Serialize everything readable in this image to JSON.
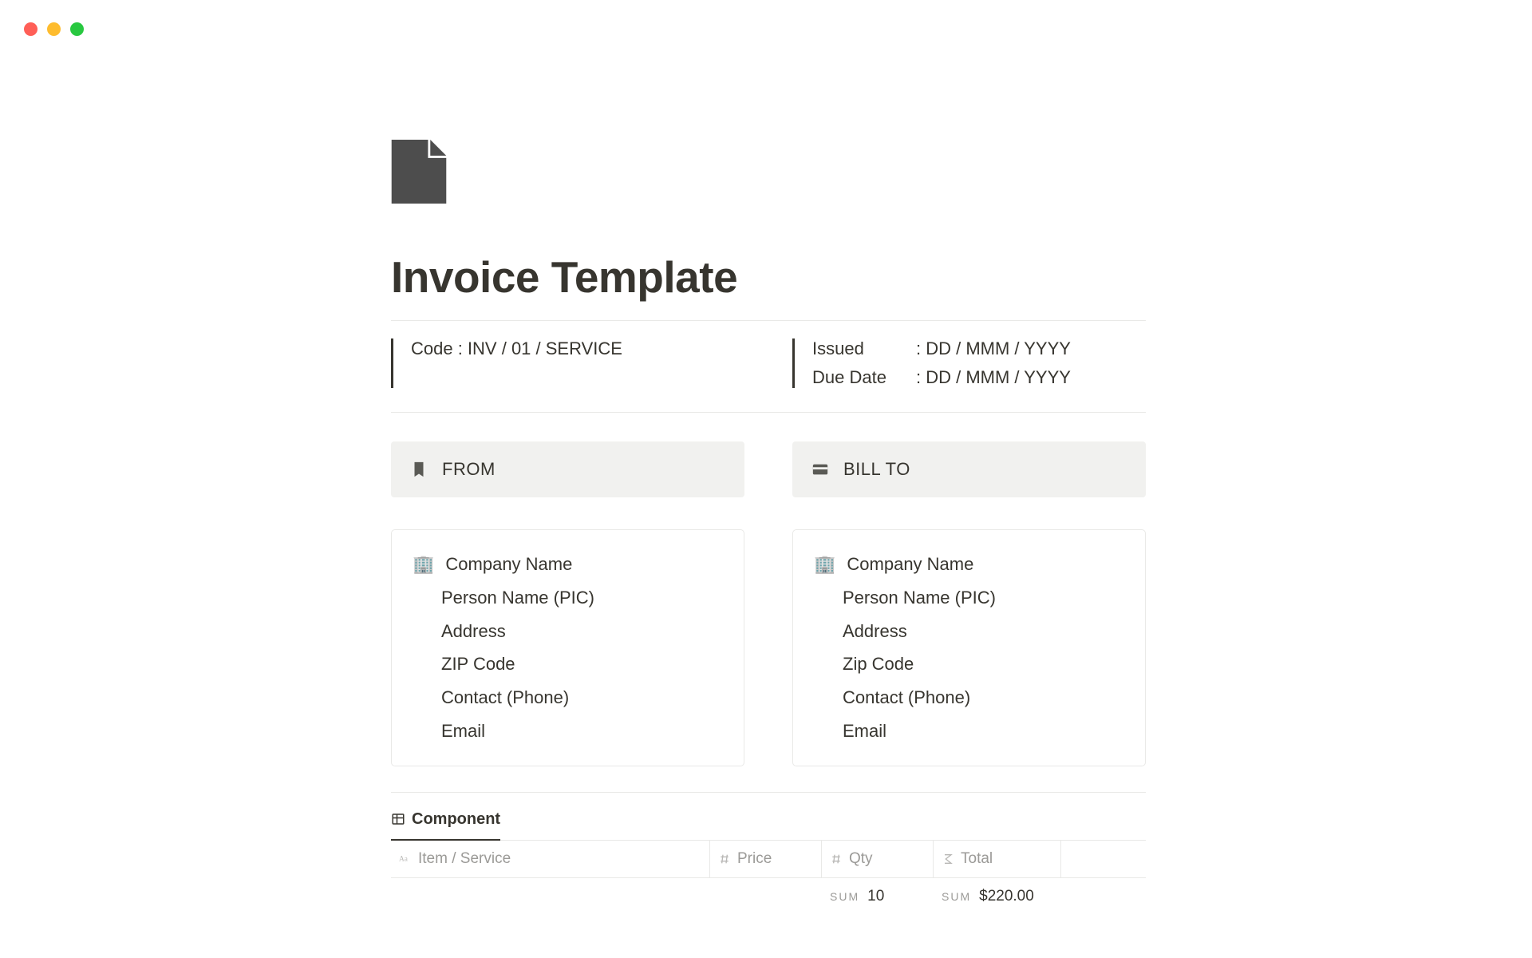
{
  "title": "Invoice Template",
  "meta": {
    "code_line": "Code : INV / 01 / SERVICE",
    "issued_label": "Issued",
    "issued_value": ": DD / MMM / YYYY",
    "due_label": "Due Date",
    "due_value": ": DD / MMM / YYYY"
  },
  "from": {
    "heading": "FROM",
    "company": "Company Name",
    "person": "Person Name (PIC)",
    "address": "Address",
    "zip": "ZIP Code",
    "contact": "Contact (Phone)",
    "email": "Email"
  },
  "bill_to": {
    "heading": "BILL TO",
    "company": "Company Name",
    "person": "Person Name (PIC)",
    "address": "Address",
    "zip": "Zip Code",
    "contact": "Contact (Phone)",
    "email": "Email"
  },
  "db": {
    "tab_label": "Component",
    "cols": {
      "item": "Item / Service",
      "price": "Price",
      "qty": "Qty",
      "total": "Total"
    },
    "sum": {
      "label": "SUM",
      "qty": "10",
      "total": "$220.00"
    }
  }
}
